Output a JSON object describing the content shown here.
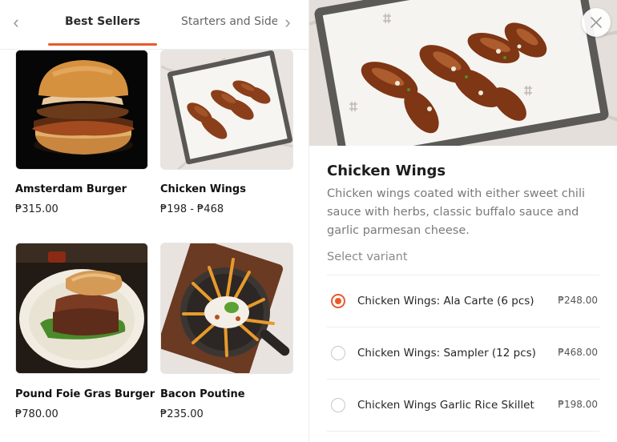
{
  "tabs": {
    "prev_icon": "chevron-left-icon",
    "next_icon": "chevron-right-icon",
    "items": [
      {
        "label": "Best Sellers",
        "active": true
      },
      {
        "label": "Starters and Sides",
        "active": false
      }
    ],
    "accent": "#e85a2a"
  },
  "products": [
    {
      "name": "Amsterdam Burger",
      "price": "₱315.00"
    },
    {
      "name": "Chicken Wings",
      "price": "₱198 - ₱468"
    },
    {
      "name": "Pound Foie Gras Burger",
      "price": "₱780.00"
    },
    {
      "name": "Bacon Poutine",
      "price": "₱235.00"
    }
  ],
  "detail": {
    "title": "Chicken Wings",
    "description": "Chicken wings coated with either sweet chili sauce with herbs, classic buffalo sauce and garlic parmesan cheese.",
    "variant_label": "Select variant",
    "close_icon": "close-icon",
    "variants": [
      {
        "name": "Chicken Wings: Ala Carte (6 pcs)",
        "price": "₱248.00",
        "selected": true
      },
      {
        "name": "Chicken Wings: Sampler (12 pcs)",
        "price": "₱468.00",
        "selected": false
      },
      {
        "name": "Chicken Wings Garlic Rice Skillet",
        "price": "₱198.00",
        "selected": false
      }
    ]
  }
}
